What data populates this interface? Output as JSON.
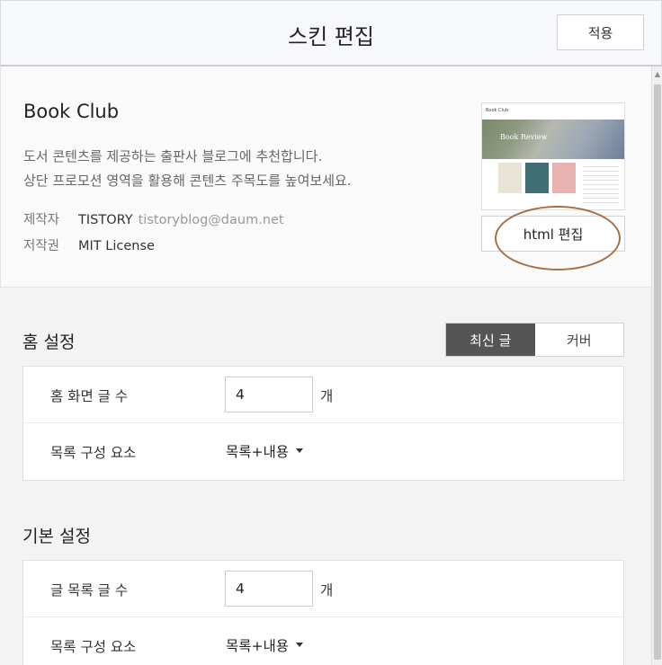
{
  "header": {
    "title": "스킨 편집",
    "apply_label": "적용"
  },
  "skin": {
    "name": "Book Club",
    "description_line1": "도서 콘텐츠를 제공하는 출판사 블로그에 추천합니다.",
    "description_line2": "상단 프로모션 영역을 활용해 콘텐츠 주목도를 높여보세요.",
    "author_label": "제작자",
    "author_name": "TISTORY",
    "author_email": "tistoryblog@daum.net",
    "license_label": "저작권",
    "license_value": "MIT License",
    "thumbnail": {
      "site_title": "Book Club",
      "hero_text": "Book Review"
    },
    "html_edit_label": "html 편집"
  },
  "home_settings": {
    "title": "홈 설정",
    "toggle": {
      "options": [
        "최신 글",
        "커버"
      ],
      "selected": "최신 글"
    },
    "post_count_label": "홈 화면 글 수",
    "post_count_value": "4",
    "post_count_unit": "개",
    "composition_label": "목록 구성 요소",
    "composition_value": "목록+내용"
  },
  "basic_settings": {
    "title": "기본 설정",
    "post_count_label": "글 목록 글 수",
    "post_count_value": "4",
    "post_count_unit": "개",
    "composition_label": "목록 구성 요소",
    "composition_value": "목록+내용"
  },
  "colors": {
    "toggle_active_bg": "#555555",
    "annotation": "#a3704a"
  }
}
